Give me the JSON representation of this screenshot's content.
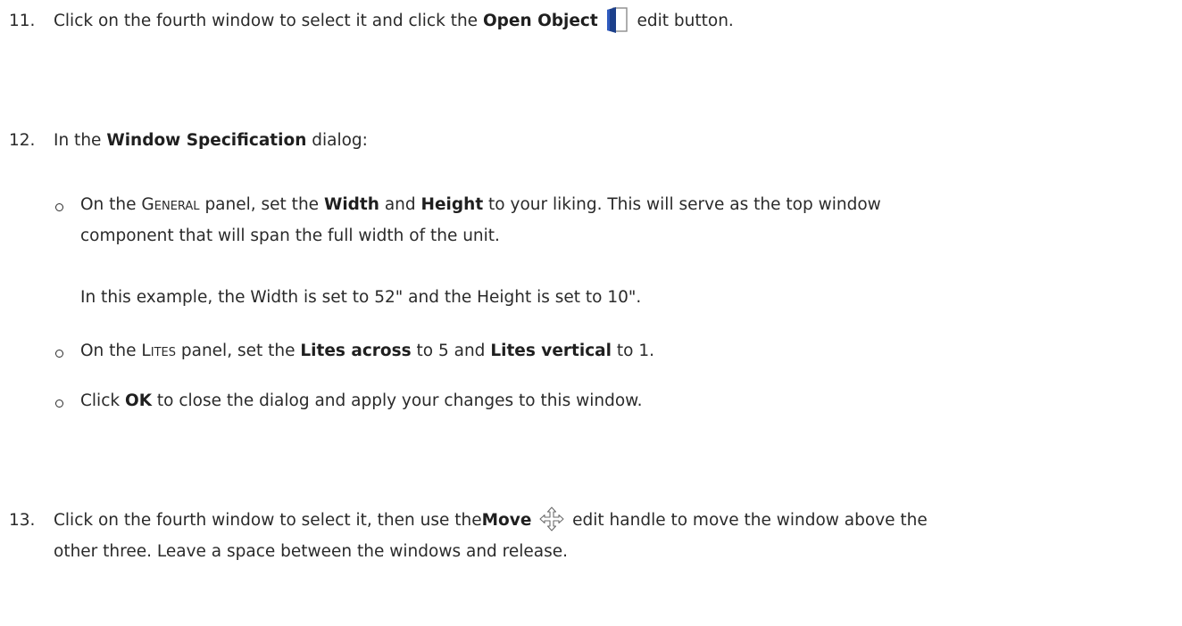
{
  "steps": [
    {
      "number": "11.",
      "pre": "Click on the fourth window to select it and click the ",
      "bold": "Open Object",
      "post": " edit button.",
      "icon": "open-object-icon"
    },
    {
      "number": "12.",
      "pre": "In the ",
      "bold": "Window Specification",
      "post": " dialog:",
      "bullets": [
        {
          "pre": "On the ",
          "panel": "General",
          "mid": " panel, set the ",
          "bold1": "Width",
          "and": " and ",
          "bold2": "Height",
          "post": " to your liking. This will serve as the top window",
          "line2": "component that will span the full width of the unit.",
          "note": "In this example, the Width is set to 52\" and the Height is set to 10\"."
        },
        {
          "pre": "On the ",
          "panel": "Lites",
          "mid": " panel, set the ",
          "bold1": "Lites across",
          "and": " to 5 and ",
          "bold2": "Lites vertical",
          "post": " to 1."
        },
        {
          "pre": "Click ",
          "bold1": "OK",
          "post": " to close the dialog and apply your changes to this window."
        }
      ]
    },
    {
      "number": "13.",
      "pre": "Click on the fourth window to select it, then use the",
      "bold": "Move",
      "post": " edit handle to move the window above the",
      "line2": "other three. Leave a space between the windows and release.",
      "icon": "move-handle-icon"
    }
  ],
  "colors": {
    "text": "#2a2a2a",
    "icon_blue": "#1c3f8a"
  }
}
